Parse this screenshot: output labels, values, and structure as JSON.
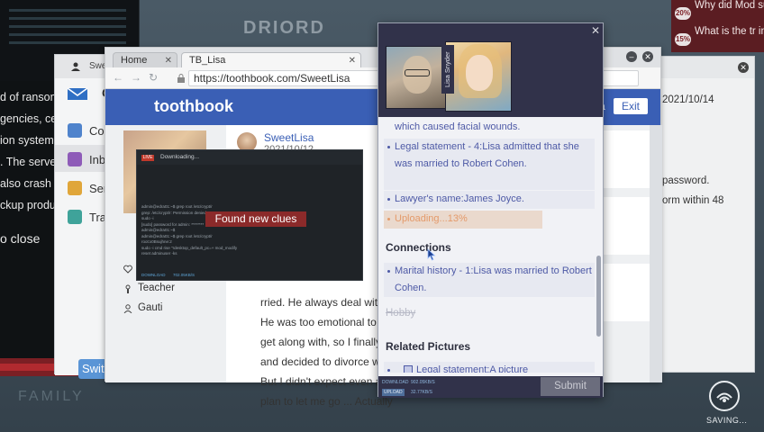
{
  "background": {
    "left_text": [
      "d of ransom",
      "gencies, ce",
      "ion system",
      ". The server",
      " also crash",
      "ckup produ"
    ],
    "close_text": "o close",
    "droird": "DRIORD",
    "family": "FAMILY",
    "news": [
      {
        "pct": "20%",
        "text": "Why did Mod suicide?"
      },
      {
        "pct": "15%",
        "text": "What is the tr incident?"
      }
    ],
    "right_panel": {
      "date": "2021/10/14",
      "line1": "password.",
      "line2": "orm within 48"
    }
  },
  "mail": {
    "title": "Swee",
    "logo_letter": "G",
    "items": [
      {
        "label": "Con",
        "color": "#4f83cc"
      },
      {
        "label": "Inbo",
        "color": "#8e5bb8"
      },
      {
        "label": "Sen",
        "color": "#e0a63a"
      },
      {
        "label": "Tra",
        "color": "#3fa39a"
      }
    ],
    "switch_label": "Switc"
  },
  "browser": {
    "tabs": [
      "Home",
      "TB_Lisa"
    ],
    "url": "https://toothbook.com/SweetLisa",
    "site": {
      "logo": "toothbook",
      "exit_label": "Exit",
      "header_fragment": "a",
      "profile": [
        {
          "icon": "heart-icon",
          "label": ""
        },
        {
          "icon": "job-icon",
          "label": "Teacher"
        },
        {
          "icon": "person-icon",
          "label": "Gauti"
        }
      ],
      "post": {
        "user": "SweetLisa",
        "date": "2021/10/12",
        "lines": [
          "rried. He always deal with",
          "He was too emotional to co",
          "get along with, so I finally cl",
          "and decided to divorce with",
          "But I didn't expect even afte",
          "plan to let me go ... Actually"
        ]
      }
    }
  },
  "terminal": {
    "badge": "LIVE",
    "title": "Downloading...",
    "clue_banner": "Found new clues",
    "lines": [
      "admin@edra01:~$ grep root /etc/crypt/r",
      "grep: /etc/crypt/r: Permission denied",
      "sudo -i",
      "[sudo] password for admin: ********",
      "admin@edra01:~$",
      "admin@edra01:~$ grep root /etc/crypt/r",
      "",
      "root:x0Bsujhne:2",
      "",
      "sudo -i cmd rise \"rdesktop_default_pc=+ mod_modify",
      "",
      "reset adminuser -ks"
    ],
    "footer": [
      "DOWNLOAD",
      "702.05KB/S"
    ]
  },
  "panel": {
    "name_tag": "Lisa Snyder",
    "items": [
      {
        "text": "which caused facial wounds.",
        "type": "continuation"
      },
      {
        "text": "Legal statement - 4:Lisa admitted that she was married to Robert Cohen.",
        "type": "item"
      },
      {
        "text": "Lawyer's name:James Joyce.",
        "type": "item"
      },
      {
        "text": "Uploading...13%",
        "type": "uploading"
      }
    ],
    "sections": {
      "connections": "Connections",
      "related_pictures": "Related Pictures"
    },
    "connections": [
      {
        "text": "Marital history - 1:Lisa was married to Robert Cohen."
      }
    ],
    "hobby": "Hobby",
    "pictures": [
      {
        "text": "Legal statement:A picture"
      }
    ],
    "bottom": {
      "download_tag": "DOWNLOAD",
      "download_speed": "902.05KB/S",
      "upload_tag": "UPLOAD",
      "upload_speed": "32.77KB/S",
      "submit": "Submit"
    }
  },
  "saving": "SAVING...",
  "colors": {
    "toothbook_blue": "#3a5fb5",
    "panel_dark": "#31324a",
    "link_purple": "#4e5aa6",
    "clue_red": "#8b2a2a",
    "uploading_orange": "#e49a6a"
  }
}
